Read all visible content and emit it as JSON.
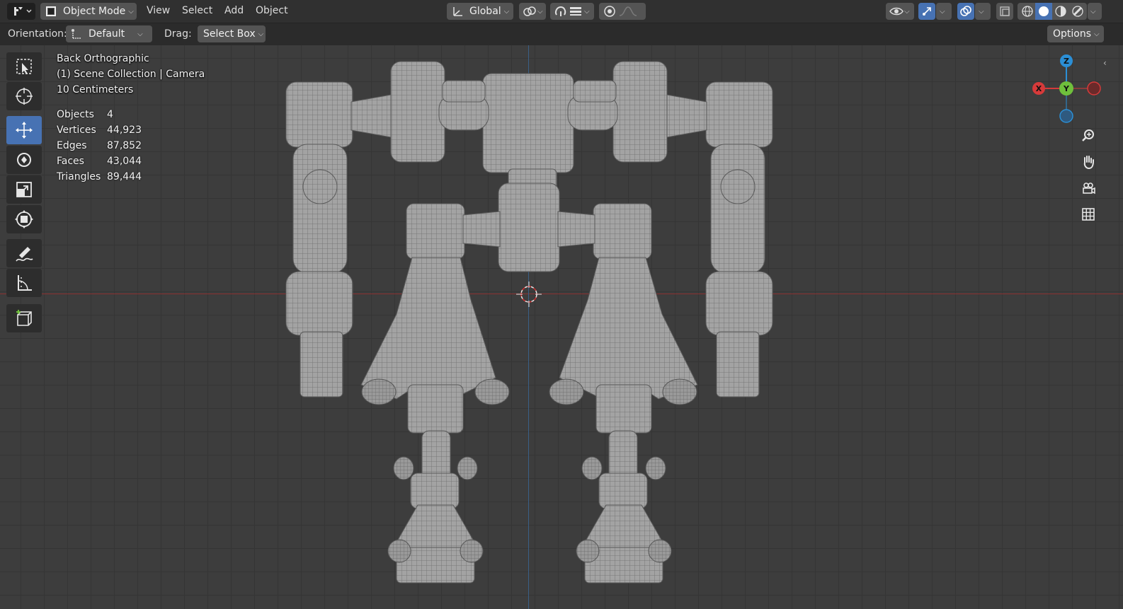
{
  "header": {
    "mode_label": "Object Mode",
    "menu": [
      "View",
      "Select",
      "Add",
      "Object"
    ],
    "transform_orientation": "Global",
    "options_label": "Options"
  },
  "tool_settings": {
    "orientation_label": "Orientation:",
    "orientation_value": "Default",
    "drag_label": "Drag:",
    "drag_value": "Select Box"
  },
  "viewport": {
    "view_name": "Back Orthographic",
    "collection": "(1) Scene Collection | Camera",
    "scale": "10 Centimeters"
  },
  "stats": [
    {
      "label": "Objects",
      "value": "4"
    },
    {
      "label": "Vertices",
      "value": "44,923"
    },
    {
      "label": "Edges",
      "value": "87,852"
    },
    {
      "label": "Faces",
      "value": "43,044"
    },
    {
      "label": "Triangles",
      "value": "89,444"
    }
  ],
  "gizmo": {
    "x": "X",
    "y": "Y",
    "z": "Z"
  },
  "tools": [
    "select-box-icon",
    "cursor-icon",
    "move-icon",
    "rotate-icon",
    "scale-icon",
    "transform-icon",
    "annotate-icon",
    "measure-icon",
    "add-cube-icon"
  ],
  "colors": {
    "accent": "#4772b3",
    "x_axis": "#d63a3a",
    "y_axis": "#6fbf3c",
    "z_axis": "#2b8fd6"
  }
}
